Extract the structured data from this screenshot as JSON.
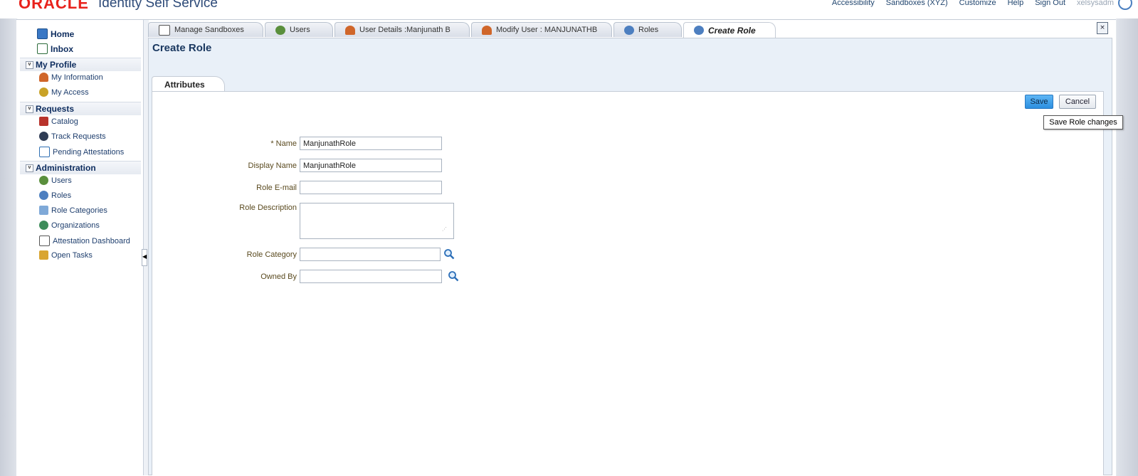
{
  "header": {
    "logo": "ORACLE",
    "app_title": "Identity Self Service",
    "links": [
      "Accessibility",
      "Sandboxes (XYZ)",
      "Customize",
      "Help",
      "Sign Out"
    ],
    "username": "xelsysadm"
  },
  "nav": {
    "home": "Home",
    "inbox": "Inbox",
    "sections": [
      {
        "title": "My Profile",
        "items": [
          "My Information",
          "My Access"
        ]
      },
      {
        "title": "Requests",
        "items": [
          "Catalog",
          "Track Requests",
          "Pending Attestations"
        ]
      },
      {
        "title": "Administration",
        "items": [
          "Users",
          "Roles",
          "Role Categories",
          "Organizations",
          "Attestation Dashboard",
          "Open Tasks"
        ]
      }
    ]
  },
  "tabs": [
    "Manage Sandboxes",
    "Users",
    "User Details :Manjunath B",
    "Modify User : MANJUNATHB",
    "Roles",
    "Create Role"
  ],
  "page": {
    "title": "Create Role",
    "subtab": "Attributes",
    "save_label": "Save",
    "cancel_label": "Cancel",
    "tooltip": "Save Role  changes"
  },
  "form": {
    "name_label": "* Name",
    "name_value": "ManjunathRole",
    "display_name_label": "Display Name",
    "display_name_value": "ManjunathRole",
    "email_label": "Role E-mail",
    "email_value": "",
    "description_label": "Role Description",
    "description_value": "",
    "category_label": "Role Category",
    "category_value": "",
    "owned_by_label": "Owned By",
    "owned_by_value": ""
  },
  "colors": {
    "brand_red": "#e8221c",
    "save_blue": "#2c8fe0",
    "label_brown": "#5a4a1f",
    "nav_blue": "#1f3f6e"
  }
}
